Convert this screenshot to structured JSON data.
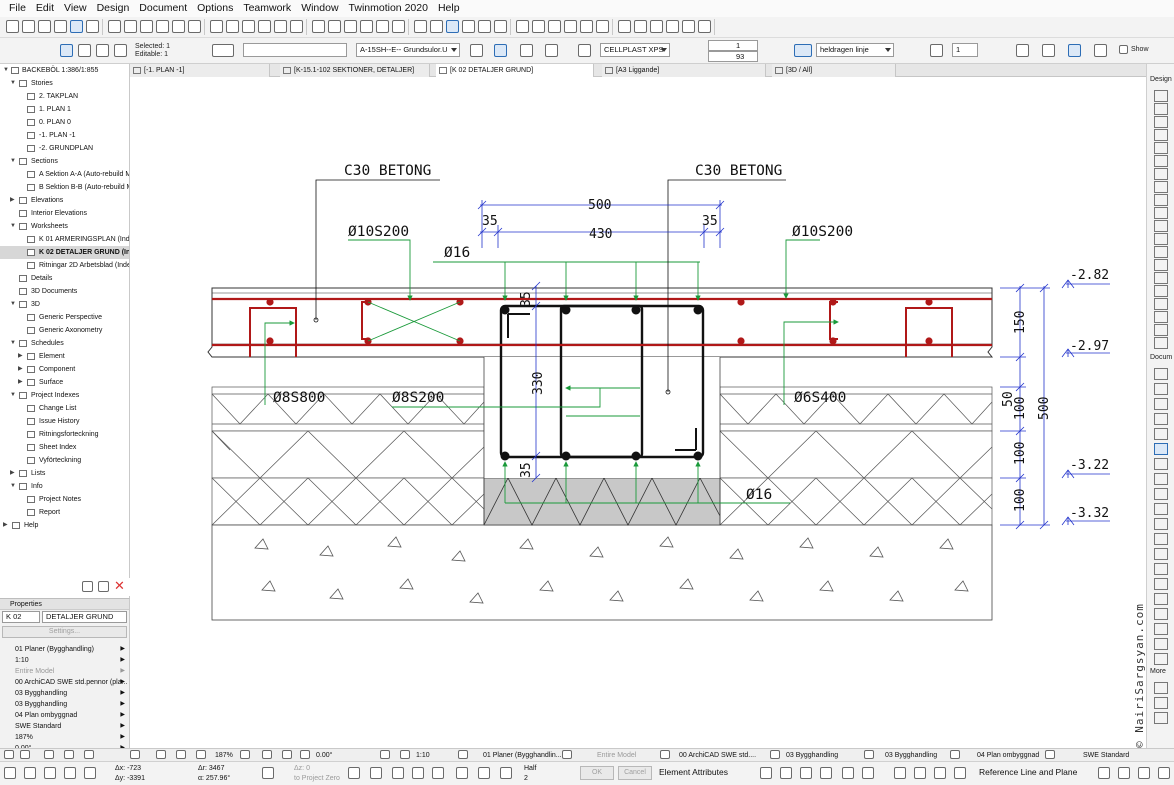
{
  "menu": [
    "File",
    "Edit",
    "View",
    "Design",
    "Document",
    "Options",
    "Teamwork",
    "Window",
    "Twinmotion 2020",
    "Help"
  ],
  "toolbar2": {
    "selected": "Selected: 1",
    "editable": "Editable: 1",
    "layer_combo": "A-15SH--E-- Grundsulor.U",
    "composite_combo": "CELLPLAST XPS",
    "pen_value": "1",
    "pen_value2": "93",
    "line_type": "heldragen linje",
    "show_value": "1",
    "show_label": "Show"
  },
  "navigator": {
    "root": "BACKEBÖL 1:386/1:855",
    "items": [
      {
        "label": "Stories",
        "level": 1,
        "open": true
      },
      {
        "label": "2. TAKPLAN",
        "level": 2
      },
      {
        "label": "1. PLAN 1",
        "level": 2
      },
      {
        "label": "0. PLAN 0",
        "level": 2
      },
      {
        "label": "-1. PLAN -1",
        "level": 2
      },
      {
        "label": "-2. GRUNDPLAN",
        "level": 2
      },
      {
        "label": "Sections",
        "level": 1,
        "open": true
      },
      {
        "label": "A Sektion A-A (Auto-rebuild M",
        "level": 2
      },
      {
        "label": "B Sektion B-B (Auto-rebuild M",
        "level": 2
      },
      {
        "label": "Elevations",
        "level": 1,
        "open": false
      },
      {
        "label": "Interior Elevations",
        "level": 1,
        "open": false,
        "noarrow": true
      },
      {
        "label": "Worksheets",
        "level": 1,
        "open": true
      },
      {
        "label": "K 01 ARMERINGSPLAN (Indepe",
        "level": 2
      },
      {
        "label": "K 02 DETALJER GRUND (Indep",
        "level": 2,
        "selected": true
      },
      {
        "label": "Ritningar 2D Arbetsblad (Inde",
        "level": 2
      },
      {
        "label": "Details",
        "level": 1,
        "noarrow": true
      },
      {
        "label": "3D Documents",
        "level": 1,
        "noarrow": true
      },
      {
        "label": "3D",
        "level": 1,
        "open": true
      },
      {
        "label": "Generic Perspective",
        "level": 2
      },
      {
        "label": "Generic Axonometry",
        "level": 2
      },
      {
        "label": "Schedules",
        "level": 1,
        "open": true
      },
      {
        "label": "Element",
        "level": 2,
        "arrow": true
      },
      {
        "label": "Component",
        "level": 2,
        "arrow": true
      },
      {
        "label": "Surface",
        "level": 2,
        "arrow": true
      },
      {
        "label": "Project Indexes",
        "level": 1,
        "open": true
      },
      {
        "label": "Change List",
        "level": 2
      },
      {
        "label": "Issue History",
        "level": 2
      },
      {
        "label": "Ritningsforteckning",
        "level": 2
      },
      {
        "label": "Sheet Index",
        "level": 2
      },
      {
        "label": "Vyförteckning",
        "level": 2
      },
      {
        "label": "Lists",
        "level": 1,
        "open": false
      },
      {
        "label": "Info",
        "level": 1,
        "open": true
      },
      {
        "label": "Project Notes",
        "level": 2
      },
      {
        "label": "Report",
        "level": 2
      },
      {
        "label": "Help",
        "level": 0,
        "open": false
      }
    ]
  },
  "properties": {
    "title": "Properties",
    "id": "K 02",
    "name": "DETALJER GRUND",
    "settings_button": "Settings...",
    "rows": [
      "01 Planer (Bygghandling)",
      "1:10",
      "Entire Model",
      "00 ArchiCAD SWE std.pennor (pla...",
      "03 Bygghandling",
      "03 Bygghandling",
      "04 Plan ombyggnad",
      "SWE Standard",
      "187%",
      "0.00°"
    ]
  },
  "tabs": [
    {
      "label": "[-1. PLAN -1]"
    },
    {
      "label": "[K-15.1-102 SEKTIONER, DETALJER]"
    },
    {
      "label": "[K 02 DETALJER GRUND]",
      "active": true
    },
    {
      "label": "[A3 Liggande]"
    },
    {
      "label": "[3D / All]"
    }
  ],
  "drawing": {
    "labels": {
      "c30_left": "C30 BETONG",
      "c30_right": "C30 BETONG",
      "rebar_left": "Ø10S200",
      "rebar_right": "Ø10S200",
      "phi16_top": "Ø16",
      "phi16_bottom": "Ø16",
      "s800": "Ø8S800",
      "s200": "Ø8S200",
      "s400": "Ø6S400"
    },
    "dims": {
      "d500": "500",
      "d35a": "35",
      "d35b": "35",
      "d430": "430",
      "v35top": "35",
      "v330": "330",
      "v35bot": "35",
      "r150": "150",
      "r50": "50",
      "r100a": "100",
      "r100b": "100",
      "r100c": "100",
      "r500": "500"
    },
    "levels": {
      "l1": "-2.82",
      "l2": "-2.97",
      "l3": "-3.22",
      "l4": "-3.32"
    },
    "watermark": "© NairiSargsyan.com"
  },
  "rightbar": {
    "design": "Design",
    "docum": "Docum",
    "more": "More"
  },
  "status1": {
    "zoom": "187%",
    "angle": "0.00°",
    "scale": "1:10",
    "layer_combo": "01 Planer (Bygghandlin...",
    "model": "Entire Model",
    "pen": "00 ArchiCAD SWE std....",
    "mvo": "03 Bygghandling",
    "override": "03 Bygghandling",
    "reno": "04 Plan ombyggnad",
    "dim": "SWE Standard"
  },
  "status2": {
    "dx": "Δx: -723",
    "dy": "Δy: -3391",
    "dr": "Δr: 3467",
    "da": "α: 257.96°",
    "dz": "Δz: 0",
    "to": "to Project Zero",
    "half": "Half",
    "half_val": "2",
    "ok": "OK",
    "cancel": "Cancel",
    "element_attributes": "Element Attributes",
    "ref_line": "Reference Line and Plane"
  }
}
